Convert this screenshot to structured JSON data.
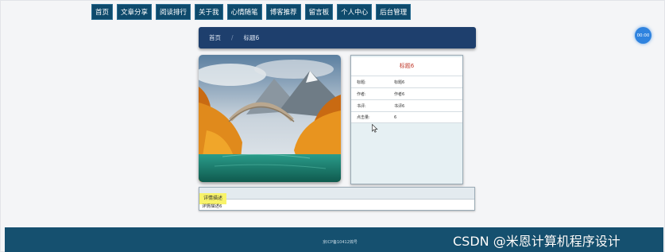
{
  "nav": {
    "items": [
      {
        "label": "首页"
      },
      {
        "label": "文章分享"
      },
      {
        "label": "阅读排行"
      },
      {
        "label": "关于我"
      },
      {
        "label": "心情随笔"
      },
      {
        "label": "博客推荐"
      },
      {
        "label": "留言板"
      },
      {
        "label": "个人中心"
      },
      {
        "label": "后台管理"
      }
    ]
  },
  "breadcrumb": {
    "home": "首页",
    "separator": "/",
    "current": "标题6"
  },
  "clock_badge": "00:00",
  "detail": {
    "title": "标题6",
    "rows": [
      {
        "key": "标题:",
        "value": "标题6"
      },
      {
        "key": "作者:",
        "value": "作者6"
      },
      {
        "key": "书评:",
        "value": "书评6"
      },
      {
        "key": "点击量:",
        "value": "6"
      }
    ]
  },
  "description": {
    "tab_label": "详情描述",
    "text": "详情描述6"
  },
  "footer": {
    "icp": "京ICP备10412鵼号"
  },
  "watermark": "CSDN @米恩计算机程序设计",
  "colors": {
    "nav_bg": "#0e4a6c",
    "breadcrumb_bg": "#1e3f6d",
    "title_red": "#c0392b",
    "footer_bg": "#15506f",
    "tab_highlight": "#f8f36a"
  }
}
